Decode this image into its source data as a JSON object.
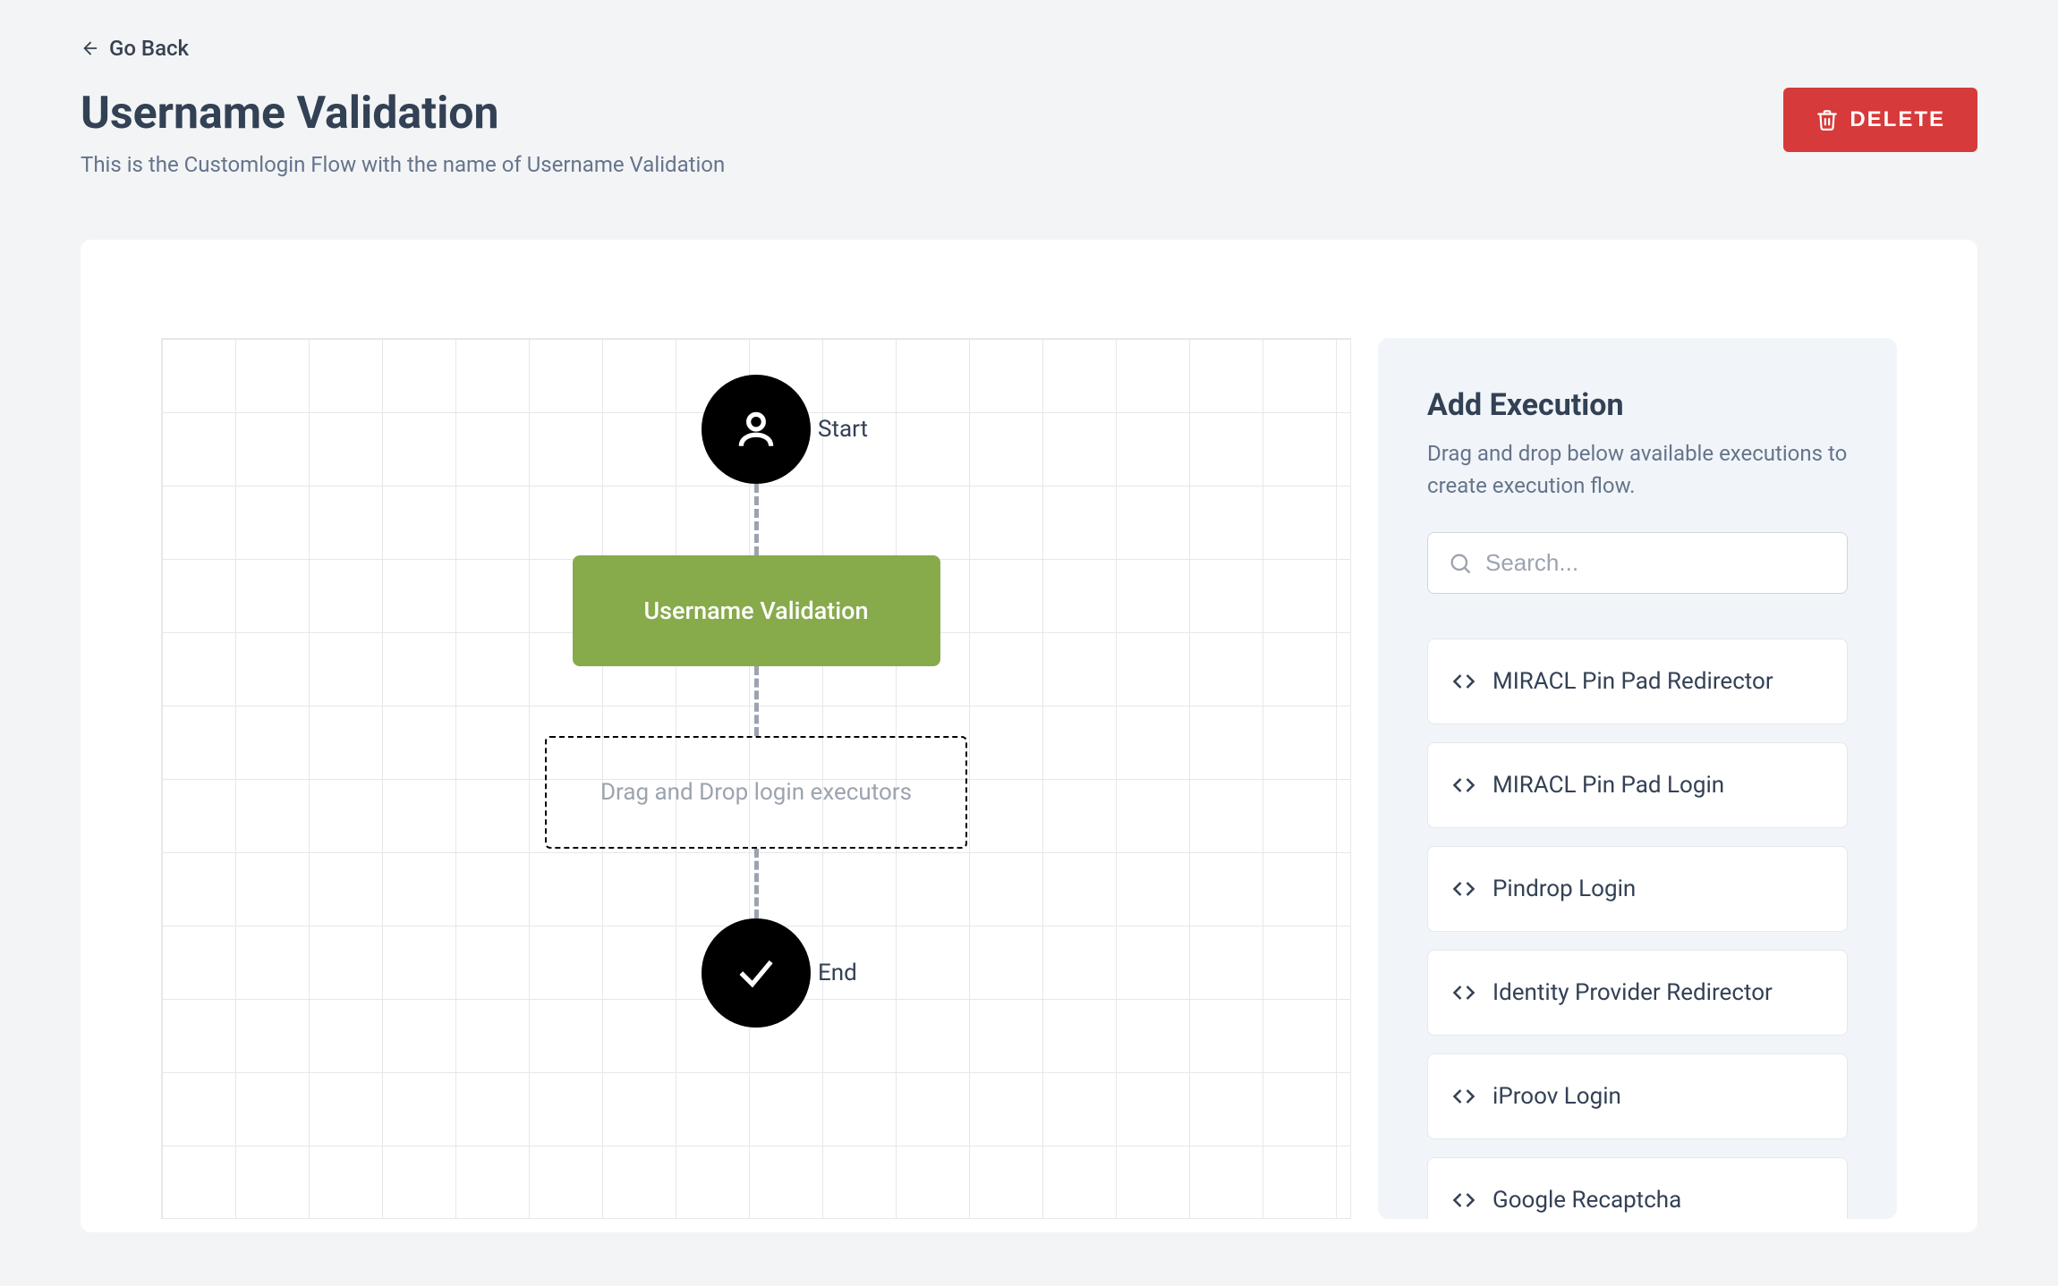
{
  "nav": {
    "go_back": "Go Back"
  },
  "header": {
    "title": "Username Validation",
    "subtitle": "This is the Customlogin Flow with the name of Username Validation",
    "delete_label": "DELETE"
  },
  "flow": {
    "start_label": "Start",
    "end_label": "End",
    "node_label": "Username Validation",
    "dropzone_label": "Drag and Drop login executors"
  },
  "sidebar": {
    "title": "Add Execution",
    "description": "Drag and drop below available executions to create execution flow.",
    "search_placeholder": "Search...",
    "executions": [
      {
        "label": "MIRACL Pin Pad Redirector"
      },
      {
        "label": "MIRACL Pin Pad Login"
      },
      {
        "label": "Pindrop Login"
      },
      {
        "label": "Identity Provider Redirector"
      },
      {
        "label": "iProov Login"
      },
      {
        "label": "Google Recaptcha"
      }
    ]
  }
}
